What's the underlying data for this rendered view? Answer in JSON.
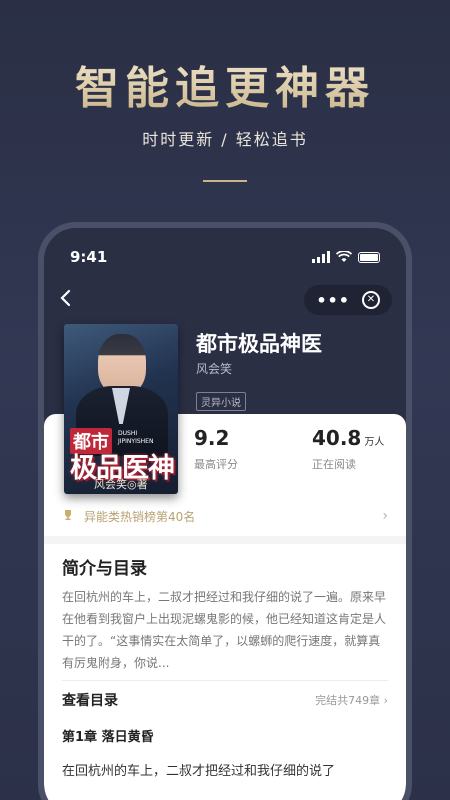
{
  "promo": {
    "title": "智能追更神器",
    "subtitle": "时时更新 / 轻松追书"
  },
  "status_bar": {
    "time": "9:41"
  },
  "book": {
    "title": "都市极品神医",
    "author": "风会笑",
    "tag": "灵异小说",
    "cover": {
      "title_top": "都市",
      "pinyin": "DUSHI JIPINYISHEN",
      "title_main": "极品医神",
      "author_line": "风会笑◎著"
    }
  },
  "stats": {
    "score_value": "9.2",
    "score_label": "最高评分",
    "reading_value": "40.8",
    "reading_unit": "万人",
    "reading_label": "正在阅读"
  },
  "rank": {
    "text": "异能类热销榜第40名"
  },
  "intro": {
    "heading": "简介与目录",
    "text": "在回杭州的车上，二叔才把经过和我仔细的说了一遍。原来早在他看到我窗户上出现泥螺鬼影的候，他已经知道这肯定是人干的了。“这事情实在太简单了，以螺蛳的爬行速度，就算真有厉鬼附身，你说..."
  },
  "toc": {
    "label": "查看目录",
    "status": "完结共749章"
  },
  "chapter": {
    "title": "第1章  落日黄昏",
    "first_line": "在回杭州的车上，二叔才把经过和我仔细的说了"
  },
  "icons": {
    "back": "chevron-left-icon",
    "more": "more-icon",
    "close": "close-circle-icon",
    "trophy": "trophy-icon",
    "chevron": "chevron-right-icon"
  },
  "colors": {
    "background": "#2c3149",
    "gold_accent": "#c9b48a",
    "rank_text": "#b9a272"
  }
}
